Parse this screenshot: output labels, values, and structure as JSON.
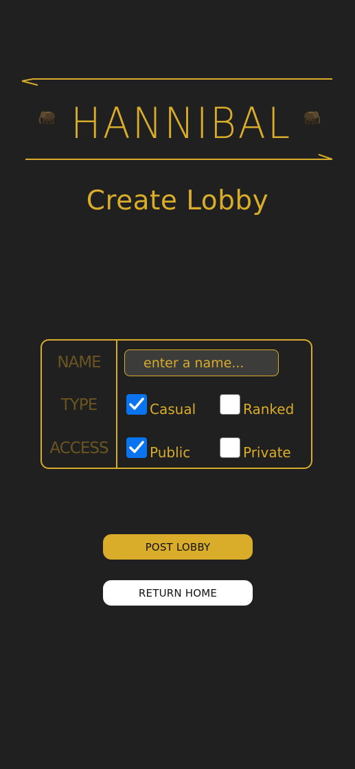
{
  "app": {
    "logo_text": "HANNIBAL",
    "accent_color": "#d9ac2a",
    "background_color": "#1f201f"
  },
  "page": {
    "title": "Create Lobby"
  },
  "form": {
    "name": {
      "label": "NAME",
      "placeholder": "enter a name...",
      "value": ""
    },
    "type": {
      "label": "TYPE",
      "options": [
        {
          "label": "Casual",
          "checked": true
        },
        {
          "label": "Ranked",
          "checked": false
        }
      ]
    },
    "access": {
      "label": "ACCESS",
      "options": [
        {
          "label": "Public",
          "checked": true
        },
        {
          "label": "Private",
          "checked": false
        }
      ]
    }
  },
  "actions": {
    "post_label": "POST LOBBY",
    "home_label": "RETURN HOME"
  },
  "icons": {
    "logo_left": "elephant-icon",
    "logo_right": "elephant-icon",
    "checkbox_checked": "checkmark-icon"
  }
}
